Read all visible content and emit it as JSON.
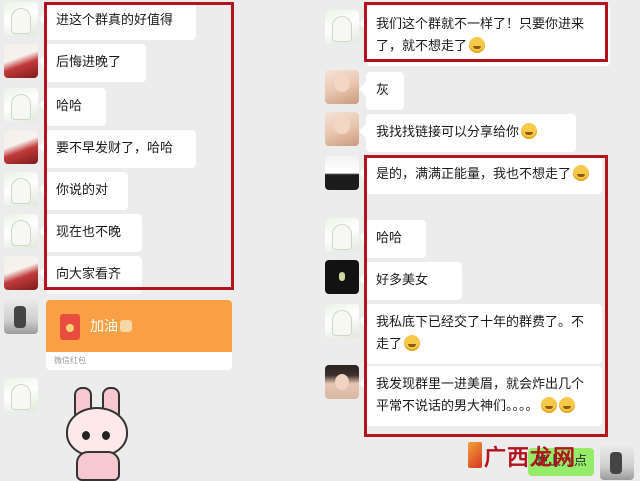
{
  "left_chat": {
    "messages": [
      {
        "text": "进这个群真的好值得",
        "avatar": "avatar-white"
      },
      {
        "text": "后悔进晚了",
        "avatar": "avatar-red"
      },
      {
        "text": "哈哈",
        "avatar": "avatar-white"
      },
      {
        "text": "要不早发财了，哈哈",
        "avatar": "avatar-red"
      },
      {
        "text": "你说的对",
        "avatar": "avatar-white"
      },
      {
        "text": "现在也不晚",
        "avatar": "avatar-white"
      },
      {
        "text": "向大家看齐",
        "avatar": "avatar-red"
      }
    ],
    "red_packet": {
      "title": "加油",
      "footer": "微信红包"
    }
  },
  "right_chat": {
    "messages": [
      {
        "text": "我们这个群就不一样了！只要你进来了，就不想走了",
        "avatar": "avatar-white",
        "emoji": "laugh-emoji"
      },
      {
        "text": "灰",
        "avatar": "avatar-pink"
      },
      {
        "text": "我找找链接可以分享给你",
        "avatar": "avatar-pink",
        "emoji": "smirk-emoji"
      },
      {
        "text": "是的，满满正能量，我也不想走了",
        "avatar": "avatar-bw",
        "emoji": "smile-emoji"
      },
      {
        "text": "哈哈",
        "avatar": "avatar-white"
      },
      {
        "text": "好多美女",
        "avatar": "avatar-black"
      },
      {
        "text": "我私底下已经交了十年的群费了。不走了",
        "avatar": "avatar-white",
        "emoji": "grin-emoji"
      },
      {
        "text": "我发现群里一进美眉，就会炸出几个平常不说话的男大神们。。。。",
        "avatar": "avatar-girl",
        "emoji": "cry-laugh-emoji"
      }
    ],
    "own_message": "晚上九点"
  },
  "watermark": "广西龙网",
  "colors": {
    "highlight": "#b3121f",
    "background": "#ececec",
    "bubble": "#ffffff",
    "own_bubble": "#95ec69",
    "red_packet": "#f8a043"
  }
}
